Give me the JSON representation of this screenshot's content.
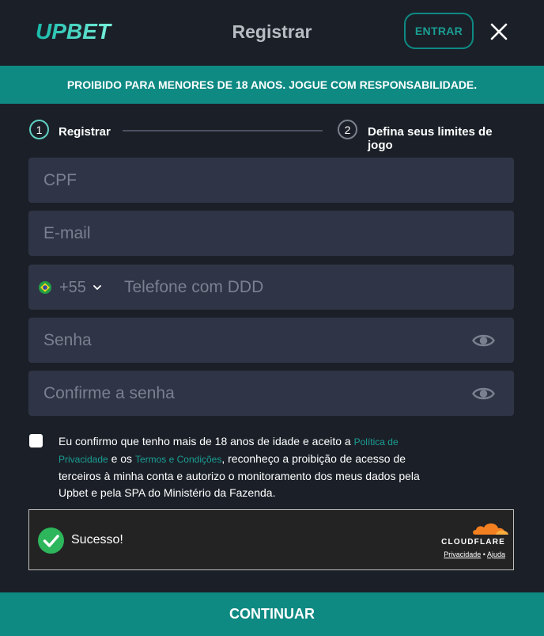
{
  "header": {
    "logo_text": "UPBET",
    "title": "Registrar",
    "login_label": "ENTRAR",
    "close_icon": "close-icon"
  },
  "banner": {
    "text": "PROIBIDO PARA MENORES DE 18 ANOS. JOGUE COM RESPONSABILIDADE."
  },
  "steps": [
    {
      "number": "1",
      "label": "Registrar",
      "active": true
    },
    {
      "number": "2",
      "label": "Defina seus limites de jogo",
      "active": false
    }
  ],
  "form": {
    "cpf_placeholder": "CPF",
    "email_placeholder": "E-mail",
    "phone": {
      "country_flag": "brazil-flag-icon",
      "country_code": "+55",
      "placeholder": "Telefone com DDD"
    },
    "password_placeholder": "Senha",
    "confirm_password_placeholder": "Confirme a senha"
  },
  "terms": {
    "text_1": "Eu confirmo que tenho mais de 18 anos de idade e aceito a ",
    "privacy_link": "Política de Privacidade",
    "text_2": " e os ",
    "terms_link": "Termos e Condições",
    "text_3": ", reconheço a proibição de acesso de terceiros à minha conta e autorizo o monitoramento dos meus dados pela Upbet e pela SPA do Ministério da Fazenda."
  },
  "captcha": {
    "status": "Sucesso!",
    "brand": "CLOUDFLARE",
    "privacy_link": "Privacidade",
    "separator": "•",
    "help_link": "Ajuda"
  },
  "continue_label": "CONTINUAR",
  "colors": {
    "background": "#1b2028",
    "accent": "#0e8a83",
    "field": "#2f3546",
    "link": "#1a9e94",
    "success": "#2db65b",
    "cloudflare": "#f38020"
  }
}
